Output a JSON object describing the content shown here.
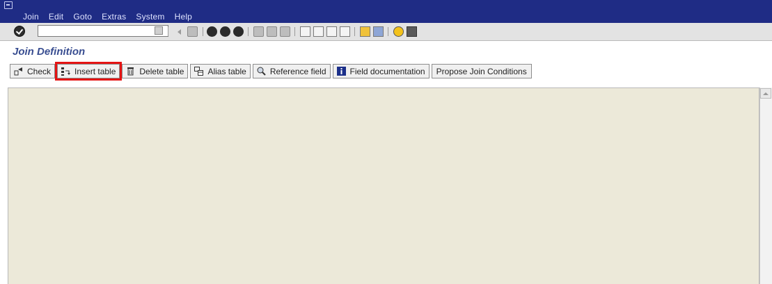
{
  "menu": [
    "Join",
    "Edit",
    "Goto",
    "Extras",
    "System",
    "Help"
  ],
  "command_field": {
    "value": ""
  },
  "screen_title": "Join Definition",
  "app_toolbar": [
    {
      "id": "check",
      "label": "Check",
      "icon": "check-icon"
    },
    {
      "id": "insert-table",
      "label": "Insert table",
      "icon": "insert-table-icon",
      "highlighted": true
    },
    {
      "id": "delete-table",
      "label": "Delete table",
      "icon": "trash-icon"
    },
    {
      "id": "alias-table",
      "label": "Alias table",
      "icon": "alias-table-icon"
    },
    {
      "id": "reference-field",
      "label": "Reference field",
      "icon": "magnifier-icon"
    },
    {
      "id": "field-documentation",
      "label": "Field documentation",
      "icon": "info-icon"
    },
    {
      "id": "propose-join",
      "label": "Propose Join Conditions",
      "icon": ""
    }
  ],
  "colors": {
    "menubar": "#1f2c85",
    "title": "#394e91",
    "content_bg": "#ece9d9",
    "highlight": "#e51414"
  }
}
